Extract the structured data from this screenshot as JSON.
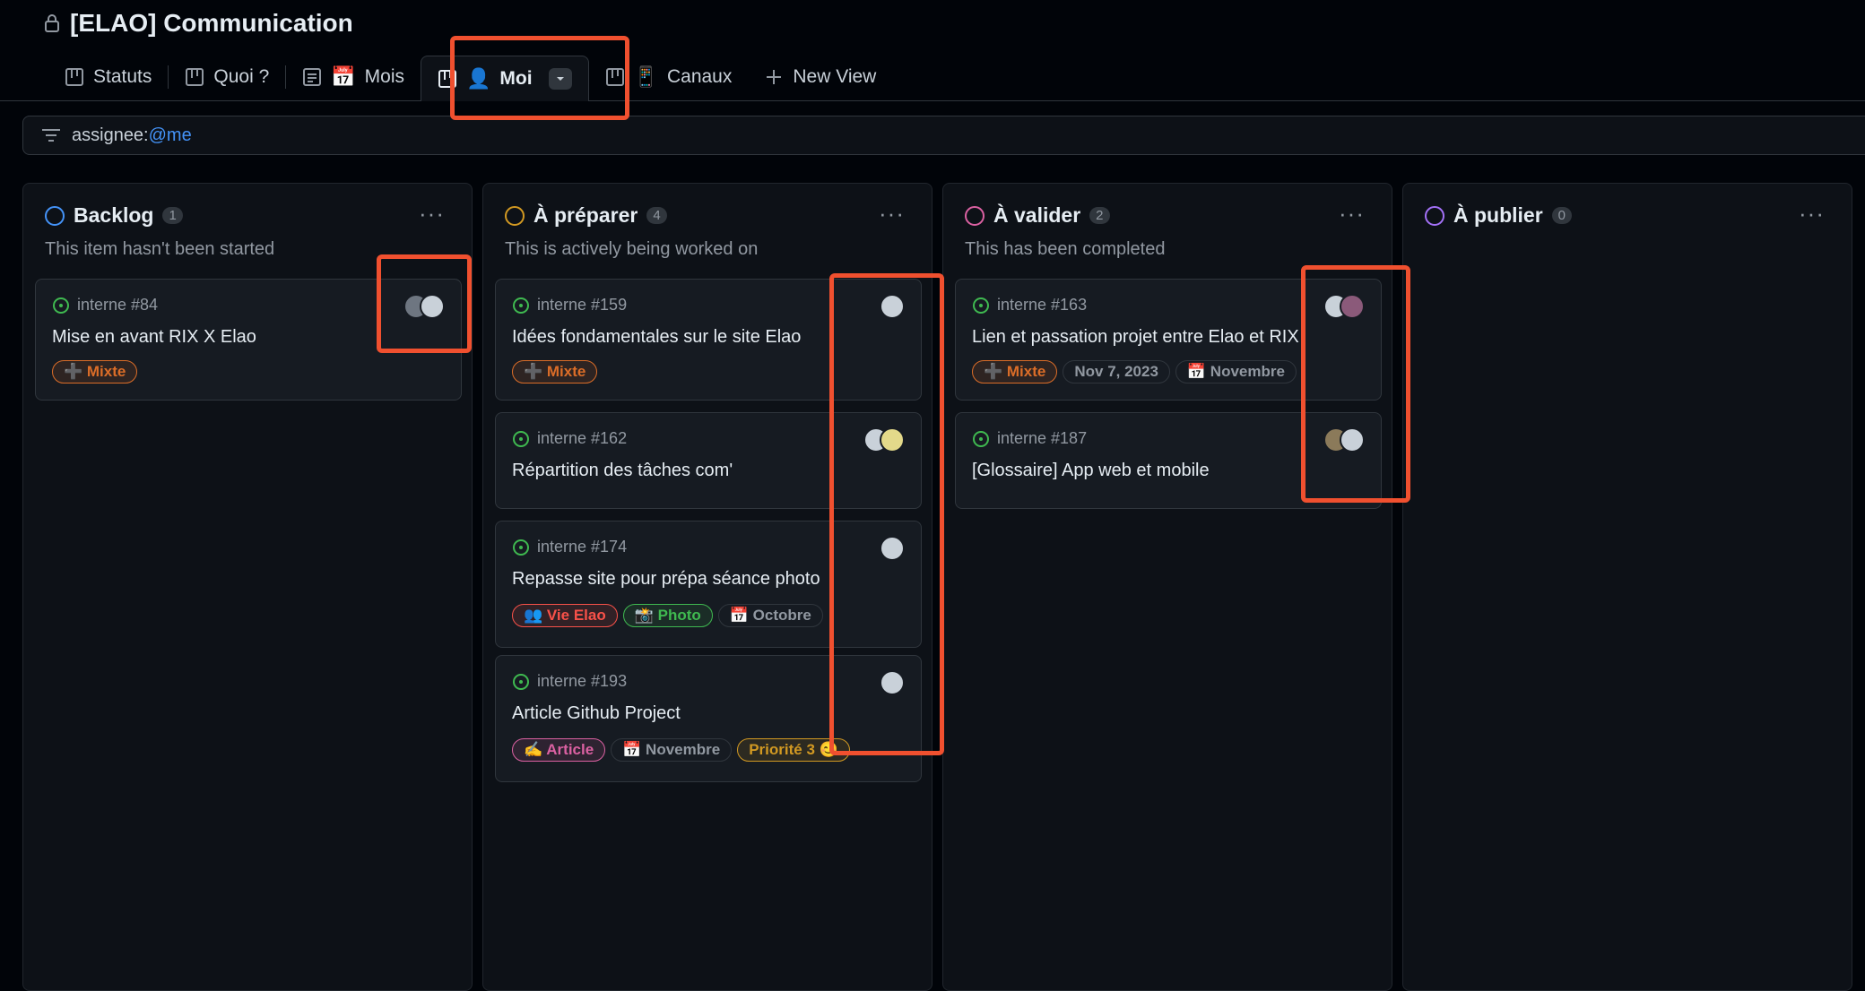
{
  "header": {
    "title": "[ELAO] Communication",
    "tabs": [
      {
        "label": "Statuts",
        "emoji": ""
      },
      {
        "label": "Quoi ?",
        "emoji": ""
      },
      {
        "label": "Mois",
        "emoji": "📅"
      },
      {
        "label": "Moi",
        "emoji": "👤"
      },
      {
        "label": "Canaux",
        "emoji": "📱"
      },
      {
        "label": "New View",
        "emoji": ""
      }
    ]
  },
  "filter": {
    "prefix": "assignee:",
    "value": "@me"
  },
  "columns": [
    {
      "name": "Backlog",
      "count": "1",
      "description": "This item hasn't been started",
      "color": "#4493f8",
      "cards": [
        {
          "issue": "interne #84",
          "title": "Mise en avant RIX X Elao",
          "labels": [
            "➕ Mixte"
          ]
        }
      ]
    },
    {
      "name": "À préparer",
      "count": "4",
      "description": "This is actively being worked on",
      "color": "#d29922",
      "cards": [
        {
          "issue": "interne #159",
          "title": "Idées fondamentales sur le site Elao",
          "labels": [
            "➕ Mixte"
          ]
        },
        {
          "issue": "interne #162",
          "title": "Répartition des tâches com'",
          "labels": []
        },
        {
          "issue": "interne #174",
          "title": "Repasse site pour prépa séance photo",
          "labels": [
            "👥 Vie Elao",
            "📸 Photo",
            "📅 Octobre"
          ]
        },
        {
          "issue": "interne #193",
          "title": "Article Github Project",
          "labels": [
            "✍️ Article",
            "📅 Novembre",
            "Priorité 3 😊"
          ]
        }
      ]
    },
    {
      "name": "À valider",
      "count": "2",
      "description": "This has been completed",
      "color": "#db61a2",
      "cards": [
        {
          "issue": "interne #163",
          "title": "Lien et passation projet entre Elao et RIX",
          "labels": [
            "➕ Mixte",
            "Nov 7, 2023",
            "📅 Novembre"
          ]
        },
        {
          "issue": "interne #187",
          "title": "[Glossaire] App web et mobile",
          "labels": []
        }
      ]
    },
    {
      "name": "À publier",
      "count": "0",
      "description": "",
      "color": "#a371f7",
      "cards": []
    }
  ],
  "colors": {
    "label_mixte": "#db6d28",
    "label_vie_elao": "#f85149",
    "label_photo": "#3fb950",
    "label_article": "#db61a2",
    "label_priorite": "#d29922",
    "issue_open": "#3fb950",
    "highlight": "#f0502f"
  }
}
